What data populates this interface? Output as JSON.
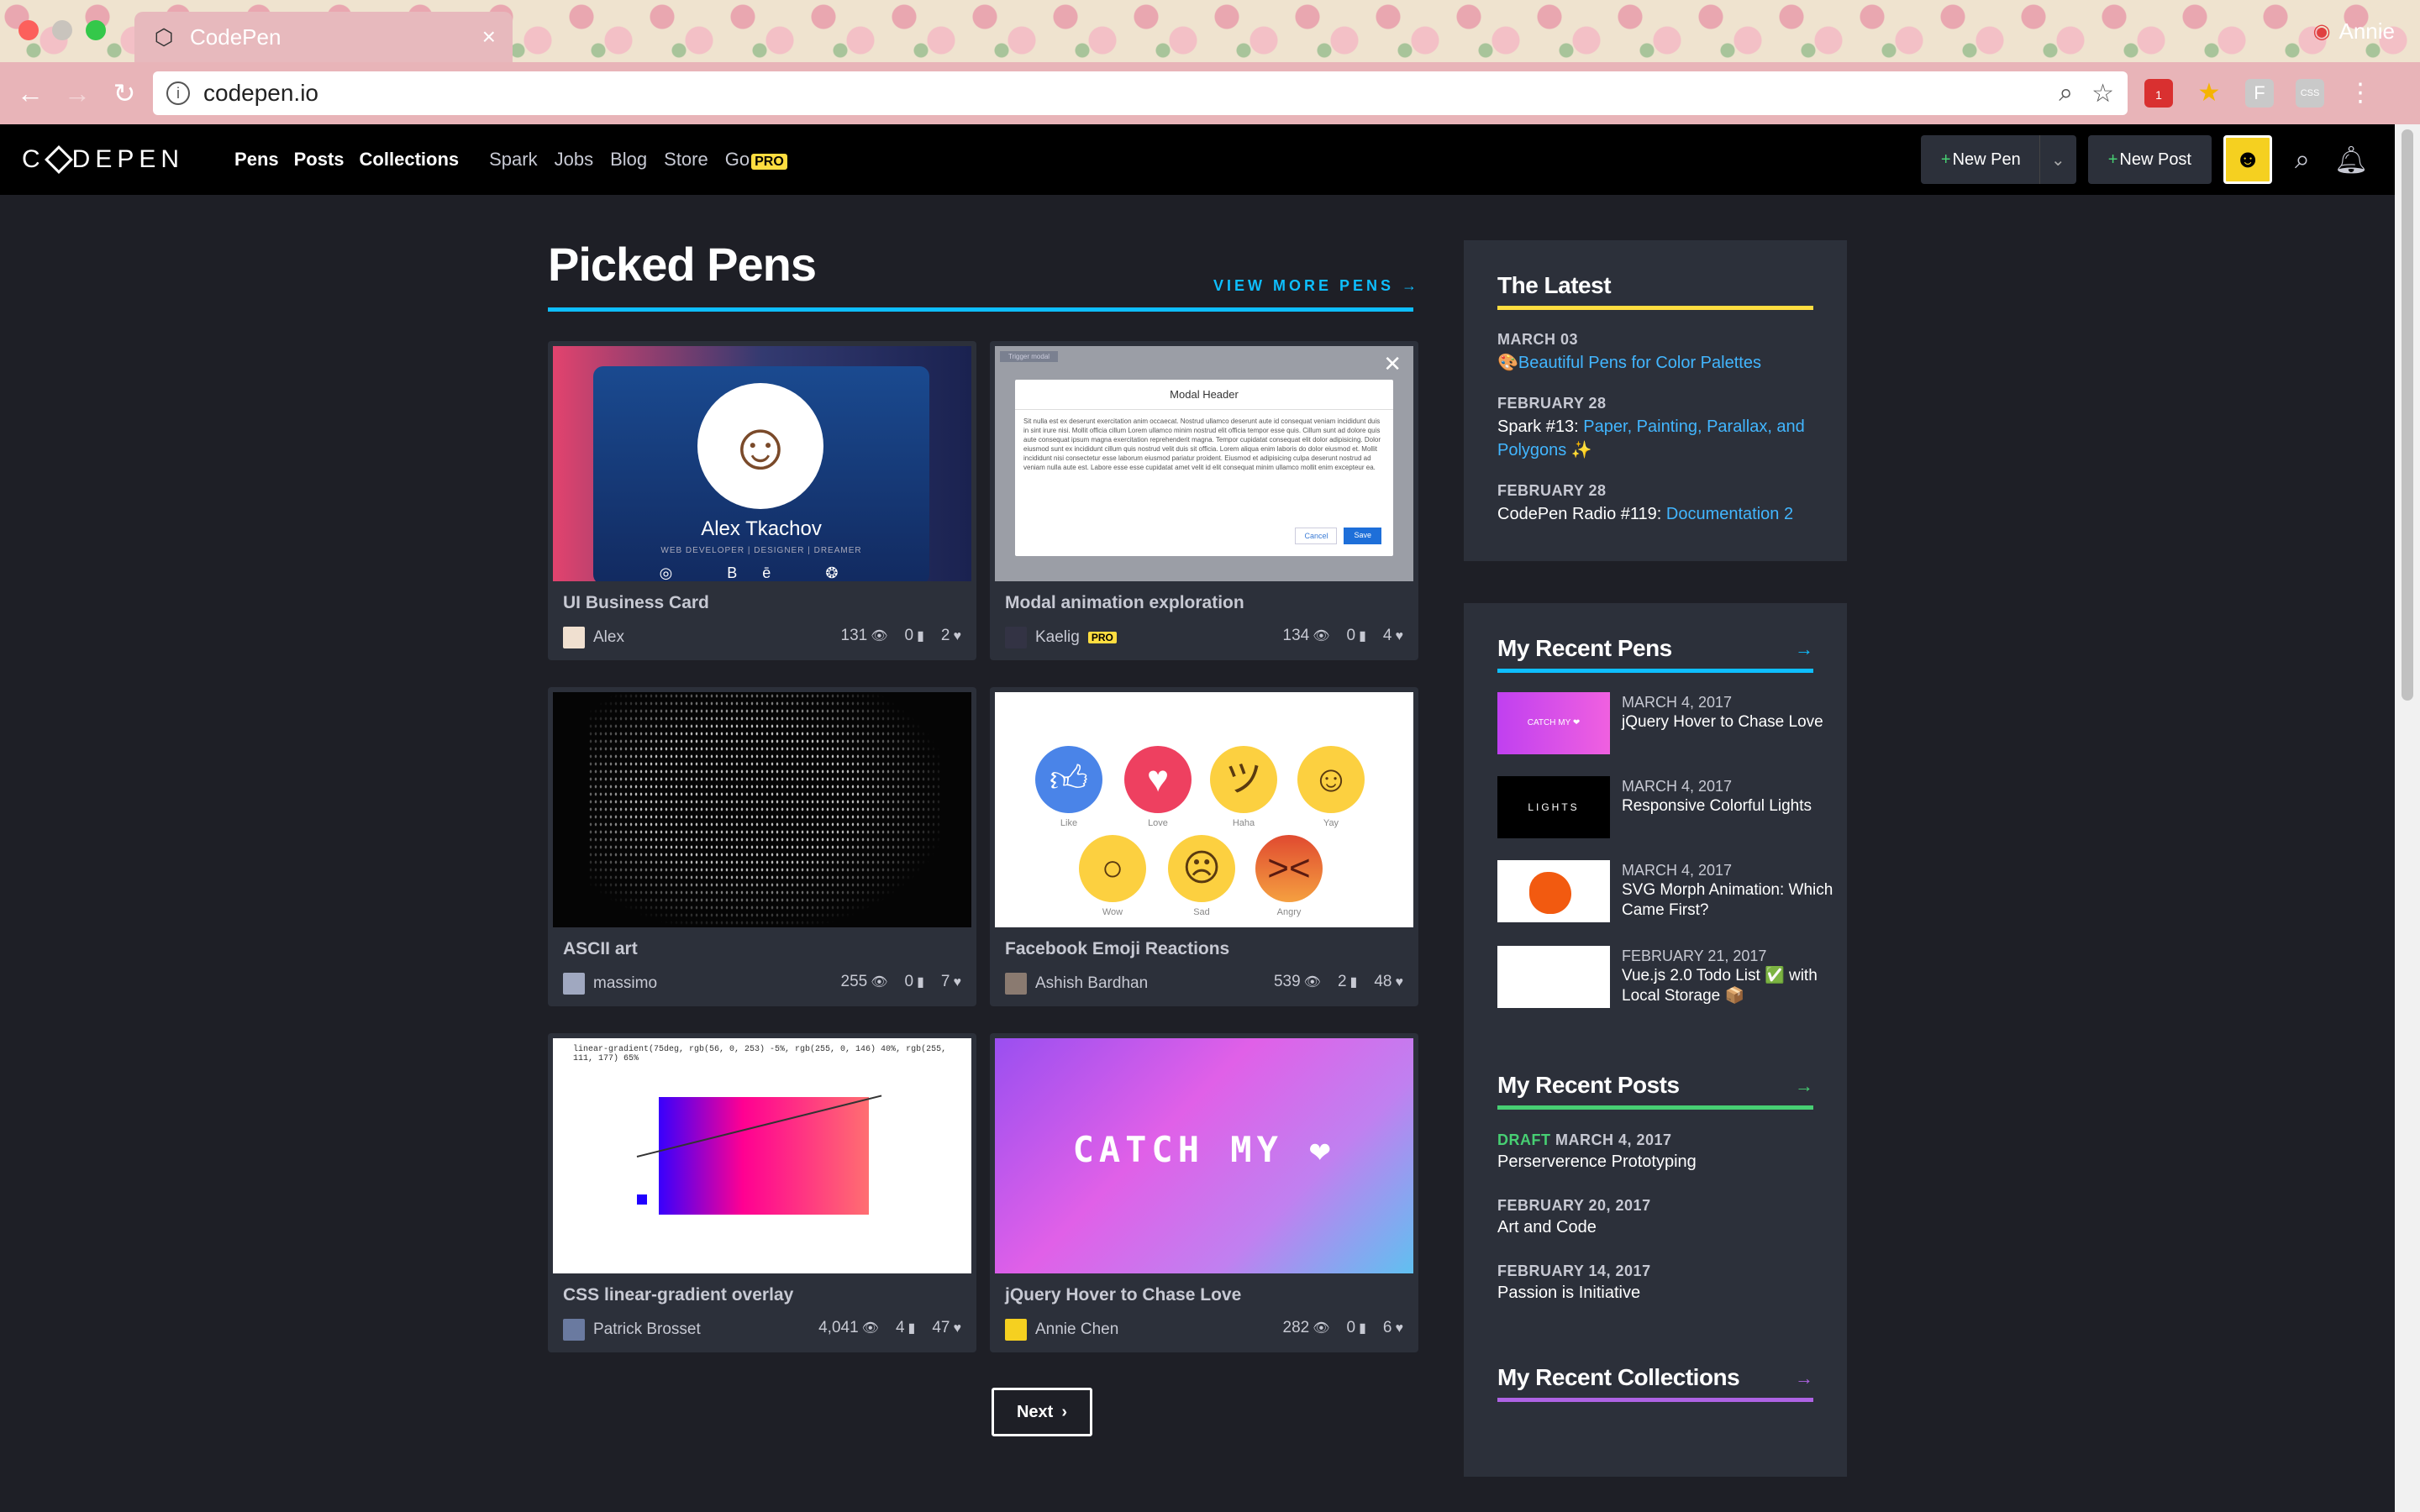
{
  "browser": {
    "tab_title": "CodePen",
    "tab_close": "×",
    "profile_name": "Annie",
    "url": "codepen.io",
    "ext_badge": "1",
    "ext_f": "F",
    "ext_css": "CSS"
  },
  "header": {
    "logo": "DEPEN",
    "logo_c": "C",
    "main_nav": [
      "Pens",
      "Posts",
      "Collections"
    ],
    "sub_nav": [
      "Spark",
      "Jobs",
      "Blog",
      "Store",
      "Go"
    ],
    "pro": "PRO",
    "new_pen": "New Pen",
    "new_post": "New Post",
    "plus": "+"
  },
  "picked": {
    "title": "Picked Pens",
    "view_more": "VIEW MORE PENS →",
    "next": "Next",
    "cards": [
      {
        "title": "UI Business Card",
        "user": "Alex",
        "views": "131",
        "comments": "0",
        "loves": "2",
        "pro": false
      },
      {
        "title": "Modal animation exploration",
        "user": "Kaelig",
        "views": "134",
        "comments": "0",
        "loves": "4",
        "pro": true
      },
      {
        "title": "ASCII art",
        "user": "massimo",
        "views": "255",
        "comments": "0",
        "loves": "7",
        "pro": false
      },
      {
        "title": "Facebook Emoji Reactions",
        "user": "Ashish Bardhan",
        "views": "539",
        "comments": "2",
        "loves": "48",
        "pro": false
      },
      {
        "title": "CSS linear-gradient overlay",
        "user": "Patrick Brosset",
        "views": "4,041",
        "comments": "4",
        "loves": "47",
        "pro": false
      },
      {
        "title": "jQuery Hover to Chase Love",
        "user": "Annie Chen",
        "views": "282",
        "comments": "0",
        "loves": "6",
        "pro": false
      }
    ],
    "business_card": {
      "name": "Alex Tkachov",
      "sub": "WEB DEVELOPER | DESIGNER | DREAMER",
      "icons": "◎ Bē ❂"
    },
    "modal": {
      "trigger": "Trigger modal",
      "header": "Modal Header",
      "text": "Sit nulla est ex deserunt exercitation anim occaecat. Nostrud ullamco deserunt aute id consequat veniam incididunt duis in sint irure nisi. Mollit officia cillum Lorem ullamco minim nostrud elit officia tempor esse quis. Cillum sunt ad dolore quis aute consequat ipsum magna exercitation reprehenderit magna. Tempor cupidatat consequat elit dolor adipisicing. Dolor eiusmod sunt ex incididunt cillum quis nostrud velit duis sit officia. Lorem aliqua enim laboris do dolor eiusmod et. Mollit incididunt nisi consectetur esse laborum eiusmod pariatur proident. Eiusmod et adipisicing culpa deserunt nostrud ad veniam nulla aute est. Labore esse esse cupidatat amet velit id elit consequat minim ullamco mollit enim excepteur ea.",
      "cancel": "Cancel",
      "save": "Save"
    },
    "emoji_labels": [
      "Like",
      "Love",
      "Haha",
      "Yay",
      "Wow",
      "Sad",
      "Angry"
    ],
    "gradient_code": "linear-gradient(75deg, rgb(56, 0, 253) -5%, rgb(255, 0, 146) 40%, rgb(255, 111, 177) 65%",
    "catch_text": "CATCH MY ❤"
  },
  "latest": {
    "title": "The Latest",
    "items": [
      {
        "date": "MARCH 03",
        "prefix": "",
        "link": "Beautiful Pens for Color Palettes",
        "suffix": "",
        "icon": "🎨"
      },
      {
        "date": "FEBRUARY 28",
        "prefix": "Spark #13: ",
        "link": "Paper, Painting, Parallax, and Polygons",
        "suffix": " ✨",
        "icon": ""
      },
      {
        "date": "FEBRUARY 28",
        "prefix": "CodePen Radio #119: ",
        "link": "Documentation 2",
        "suffix": "",
        "icon": ""
      }
    ]
  },
  "recent_pens": {
    "title": "My Recent Pens",
    "arrow": "→",
    "items": [
      {
        "date": "MARCH 4, 2017",
        "title": "jQuery Hover to Chase Love"
      },
      {
        "date": "MARCH 4, 2017",
        "title": "Responsive Colorful Lights"
      },
      {
        "date": "MARCH 4, 2017",
        "title": "SVG Morph Animation: Which Came First?"
      },
      {
        "date": "FEBRUARY 21, 2017",
        "title": "Vue.js 2.0 Todo List ✅ with Local Storage 📦"
      }
    ],
    "thumb1_text": "CATCH MY ❤",
    "thumb2_text": "LIGHTS"
  },
  "recent_posts": {
    "title": "My Recent Posts",
    "arrow": "→",
    "draft": "DRAFT",
    "items": [
      {
        "date": "MARCH 4, 2017",
        "title": "Perserverence Prototyping"
      },
      {
        "date": "FEBRUARY 20, 2017",
        "title": "Art and Code"
      },
      {
        "date": "FEBRUARY 14, 2017",
        "title": "Passion is Initiative"
      }
    ]
  },
  "recent_collections": {
    "title": "My Recent Collections",
    "arrow": "→"
  },
  "colors": {
    "blue": "#0ebeff",
    "yellow": "#ffdd40",
    "green": "#47cf73",
    "purple": "#ae63e4",
    "panel": "#2c303a",
    "page": "#1e1f26"
  }
}
